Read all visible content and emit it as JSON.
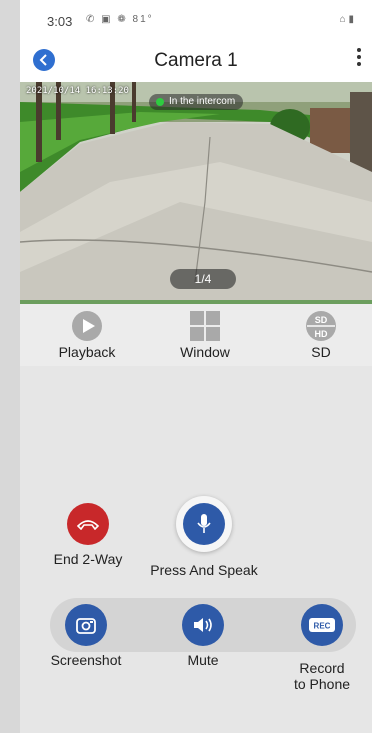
{
  "status_bar": {
    "time": "3:03",
    "left_icons": "✆ ▣ ❁ 81°",
    "right_icons": "⌂ ▮"
  },
  "header": {
    "title": "Camera 1",
    "back_icon": "chevron-left-icon",
    "more_icon": "more-vertical-icon"
  },
  "video": {
    "osd_timestamp": "2021/10/14 16:13:20",
    "badge": "In the intercom",
    "page_indicator": "1/4"
  },
  "toolbar": {
    "items": [
      {
        "label": "Playback",
        "icon": "play-circle-icon"
      },
      {
        "label": "Window",
        "icon": "grid-window-icon"
      },
      {
        "label": "SD",
        "icon": "sd-hd-icon"
      }
    ]
  },
  "controls": {
    "end_two_way": "End 2-Way",
    "press_and_speak": "Press And Speak",
    "screenshot": "Screenshot",
    "mute": "Mute",
    "record": "Record\nto Phone",
    "record_icon_text": "REC"
  },
  "colors": {
    "accent_blue": "#2e5aa8",
    "end_call_red": "#c8282a",
    "back_blue": "#2f6fd0"
  }
}
